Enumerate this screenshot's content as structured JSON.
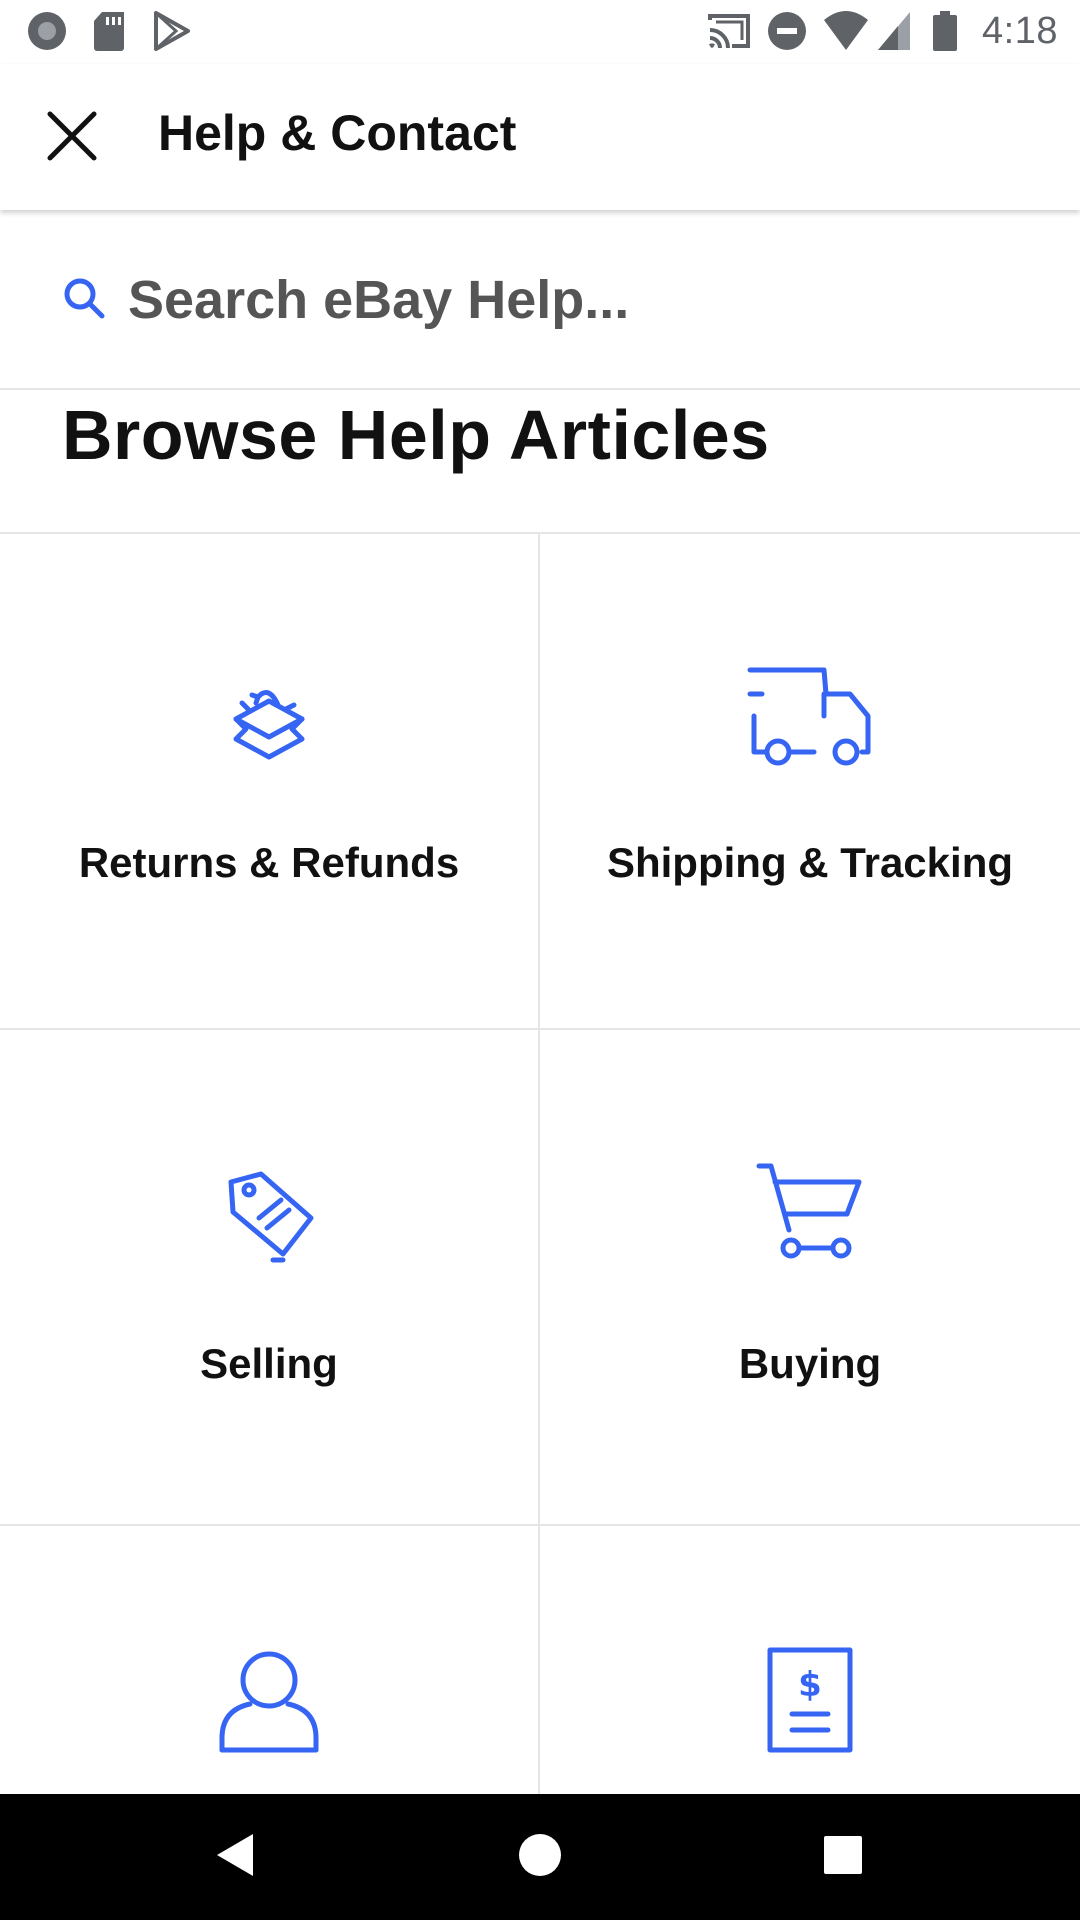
{
  "status_bar": {
    "time": "4:18",
    "left_icons": [
      "circle-app-icon",
      "sd-card-icon",
      "play-store-icon"
    ],
    "right_icons": [
      "cast-icon",
      "do-not-disturb-icon",
      "wifi-icon",
      "signal-icon",
      "battery-icon"
    ]
  },
  "app_bar": {
    "title": "Help & Contact",
    "close_icon": "close-icon"
  },
  "search": {
    "placeholder": "Search eBay Help..."
  },
  "browse": {
    "title": "Browse Help Articles"
  },
  "categories": [
    {
      "label": "Returns & Refunds",
      "icon": "returns-box-icon"
    },
    {
      "label": "Shipping & Tracking",
      "icon": "delivery-truck-icon"
    },
    {
      "label": "Selling",
      "icon": "price-tag-icon"
    },
    {
      "label": "Buying",
      "icon": "shopping-cart-icon"
    },
    {
      "label": "",
      "icon": "account-person-icon"
    },
    {
      "label": "",
      "icon": "invoice-dollar-icon"
    }
  ],
  "colors": {
    "accent_blue": "#3665f3",
    "text_primary": "#111111",
    "divider": "#e5e5e5",
    "nav_bar": "#000000"
  },
  "nav_bar": {
    "buttons": [
      "back-icon",
      "home-icon",
      "recents-icon"
    ]
  }
}
